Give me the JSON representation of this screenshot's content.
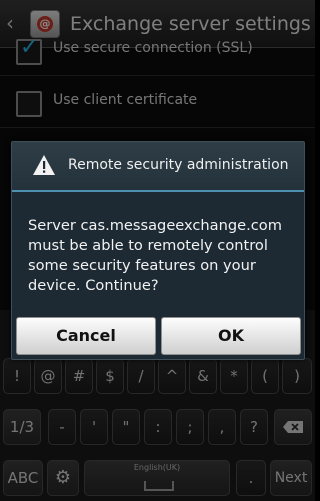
{
  "header": {
    "title": "Exchange server settings"
  },
  "settings": [
    {
      "label": "Use secure connection (SSL)",
      "checked": true
    },
    {
      "label": "Use client certificate",
      "checked": false
    }
  ],
  "dialog": {
    "title": "Remote security administration",
    "message": "Server cas.messageexchange.com must be able to remotely control some security features on your device. Continue?",
    "cancel_label": "Cancel",
    "ok_label": "OK"
  },
  "keyboard": {
    "row1": [
      "!",
      "@",
      "#",
      "$",
      "/",
      "^",
      "&",
      "*",
      "(",
      ")"
    ],
    "row2": [
      "1/3",
      "-",
      "'",
      "\"",
      ":",
      ";",
      ",",
      "?"
    ],
    "row3": {
      "abc": "ABC",
      "space_language": "English(UK)",
      "period": ".",
      "next": "Next"
    }
  },
  "colors": {
    "accent": "#4f8fb0",
    "checkbox_tick": "#28b5e8"
  }
}
